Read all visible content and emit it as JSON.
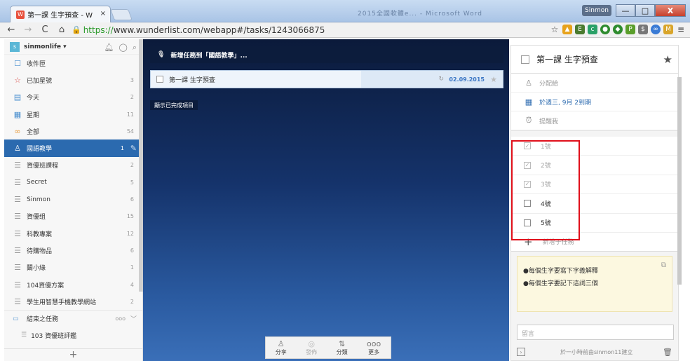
{
  "browser": {
    "tab_title": "第一課 生字預查 - W",
    "tab_close": "×",
    "tab_favicon": "W",
    "background_window_title": "2015全國軟體e... - Microsoft Word",
    "user_badge": "Sinmon",
    "btn_min": "—",
    "btn_max": "□",
    "btn_close": "X",
    "nav_back": "←",
    "nav_forward": "→",
    "nav_reload": "C",
    "nav_home": "⌂",
    "url_scheme": "https://",
    "url_rest": "www.wunderlist.com/webapp#/tasks/1243066875",
    "bookmark_star": "☆",
    "menu": "≡"
  },
  "sidebar": {
    "avatar_letter": "s",
    "username": "sinmonlife ▾",
    "items": [
      {
        "icon": "inbox-icon",
        "glyph": "☐",
        "label": "收件匣",
        "count": ""
      },
      {
        "icon": "star-icon",
        "glyph": "☆",
        "label": "已加星號",
        "count": "3"
      },
      {
        "icon": "today-icon",
        "glyph": "▤",
        "label": "今天",
        "count": "2"
      },
      {
        "icon": "week-icon",
        "glyph": "▦",
        "label": "星期",
        "count": "11"
      },
      {
        "icon": "all-icon",
        "glyph": "∞",
        "label": "全部",
        "count": "54"
      },
      {
        "icon": "shared-list-icon",
        "glyph": "♙",
        "label": "國語教學",
        "count": "1"
      },
      {
        "icon": "list-icon",
        "glyph": "☰",
        "label": "資優班課程",
        "count": "2"
      },
      {
        "icon": "list-icon",
        "glyph": "☰",
        "label": "Secret",
        "count": "5"
      },
      {
        "icon": "list-icon",
        "glyph": "☰",
        "label": "Sinmon",
        "count": "6"
      },
      {
        "icon": "list-icon",
        "glyph": "☰",
        "label": "資優组",
        "count": "15"
      },
      {
        "icon": "list-icon",
        "glyph": "☰",
        "label": "科教專案",
        "count": "12"
      },
      {
        "icon": "list-icon",
        "glyph": "☰",
        "label": "待購物品",
        "count": "6"
      },
      {
        "icon": "list-icon",
        "glyph": "☰",
        "label": "鬫小綠",
        "count": "1"
      },
      {
        "icon": "list-icon",
        "glyph": "☰",
        "label": "104資優方案",
        "count": "4"
      },
      {
        "icon": "list-icon",
        "glyph": "☰",
        "label": "學生用智慧手機教學網站",
        "count": "2"
      }
    ],
    "folder_label": "結束之任務",
    "folder_more": "ooo",
    "folder_chevron": "﹀",
    "folder_sub": "103 資優班評鑑",
    "add_list": "+"
  },
  "main": {
    "add_task_placeholder": "新增任務到「國語教學」...",
    "task_title": "第一課 生字預查",
    "task_due": "02.09.2015",
    "show_completed": "顯示已完成項目",
    "bottom": [
      {
        "icon": "share-icon",
        "glyph": "♙",
        "label": "分享"
      },
      {
        "icon": "publish-icon",
        "glyph": "◎",
        "label": "發佈"
      },
      {
        "icon": "sort-icon",
        "glyph": "⇅",
        "label": "分類"
      },
      {
        "icon": "more-icon",
        "glyph": "ooo",
        "label": "更多"
      }
    ]
  },
  "detail": {
    "title": "第一課 生字預查",
    "assign": "分配給",
    "due": "於週三, 9月 2到期",
    "reminder": "提醒我",
    "subtasks": [
      {
        "label": "1號",
        "done": true
      },
      {
        "label": "2號",
        "done": true
      },
      {
        "label": "3號",
        "done": true
      },
      {
        "label": "4號",
        "done": false
      },
      {
        "label": "5號",
        "done": false
      }
    ],
    "add_subtask": "新增子任務",
    "note_lines": [
      "●每個生字要寫下字義解釋",
      "●每個生字要記下這詞三個"
    ],
    "comment_placeholder": "留言",
    "footer": "於一小時前由sinmon11建立"
  }
}
